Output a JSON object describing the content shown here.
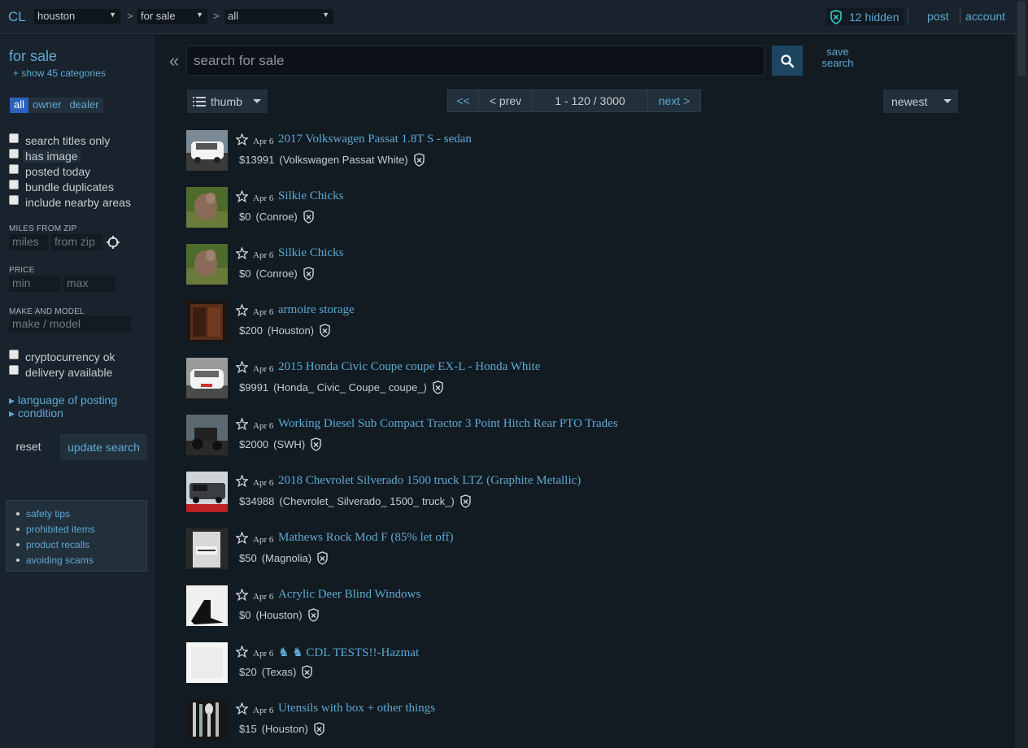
{
  "topbar": {
    "logo": "CL",
    "area": "houston",
    "section": "for sale",
    "category": "all",
    "hidden_count": "12 hidden",
    "post": "post",
    "account": "account"
  },
  "sidebar": {
    "title": "for sale",
    "show_categories": "+ show 45 categories",
    "owner_tabs": [
      "all",
      "owner",
      "dealer"
    ],
    "checkboxes": [
      "search titles only",
      "has image",
      "posted today",
      "bundle duplicates",
      "include nearby areas"
    ],
    "miles_label": "MILES FROM ZIP",
    "miles_placeholder": "miles",
    "zip_placeholder": "from zip",
    "price_label": "PRICE",
    "min_placeholder": "min",
    "max_placeholder": "max",
    "make_label": "MAKE AND MODEL",
    "make_placeholder": "make / model",
    "checkboxes2": [
      "cryptocurrency ok",
      "delivery available"
    ],
    "expanders": [
      "▸ language of posting",
      "▸ condition"
    ],
    "reset": "reset",
    "update": "update search",
    "help": [
      "safety tips",
      "prohibited items",
      "product recalls",
      "avoiding scams"
    ]
  },
  "main": {
    "collapse": "«",
    "search_placeholder": "search for sale",
    "save_search": [
      "save",
      "search"
    ],
    "view": "thumb",
    "pager": {
      "first": "<<",
      "prev": "< prev",
      "range": "1 - 120 / 3000",
      "next": "next >"
    },
    "sort": "newest"
  },
  "results": [
    {
      "date": "Apr 6",
      "title": "2017 Volkswagen Passat 1.8T S - sedan",
      "price": "$13991",
      "location": "(Volkswagen Passat White)",
      "thumb": "car-white"
    },
    {
      "date": "Apr 6",
      "title": "Silkie Chicks",
      "price": "$0",
      "location": "(Conroe)",
      "thumb": "chick"
    },
    {
      "date": "Apr 6",
      "title": "Silkie Chicks",
      "price": "$0",
      "location": "(Conroe)",
      "thumb": "chick"
    },
    {
      "date": "Apr 6",
      "title": "armoire storage",
      "price": "$200",
      "location": "(Houston)",
      "thumb": "armoire"
    },
    {
      "date": "Apr 6",
      "title": "2015 Honda Civic Coupe coupe EX-L - Honda White",
      "price": "$9991",
      "location": "(Honda_ Civic_ Coupe_ coupe_)",
      "thumb": "car-white2"
    },
    {
      "date": "Apr 6",
      "title": "Working Diesel Sub Compact Tractor 3 Point Hitch Rear PTO Trades",
      "price": "$2000",
      "location": "(SWH)",
      "thumb": "tractor"
    },
    {
      "date": "Apr 6",
      "title": "2018 Chevrolet Silverado 1500 truck LTZ (Graphite Metallic)",
      "price": "$34988",
      "location": "(Chevrolet_ Silverado_ 1500_ truck_)",
      "thumb": "truck"
    },
    {
      "date": "Apr 6",
      "title": "Mathews Rock Mod F (85% let off)",
      "price": "$50",
      "location": "(Magnolia)",
      "thumb": "package"
    },
    {
      "date": "Apr 6",
      "title": "Acrylic Deer Blind Windows",
      "price": "$0",
      "location": "(Houston)",
      "thumb": "acrylic"
    },
    {
      "date": "Apr 6",
      "title": "♞ ♞ CDL TESTS!!-Hazmat",
      "price": "$20",
      "location": "(Texas)",
      "thumb": "white"
    },
    {
      "date": "Apr 6",
      "title": "Utensils with box + other things",
      "price": "$15",
      "location": "(Houston)",
      "thumb": "utensils"
    }
  ],
  "colors": {
    "link": "#5fa8d3",
    "background": "#121b22",
    "panel": "#18232d"
  }
}
